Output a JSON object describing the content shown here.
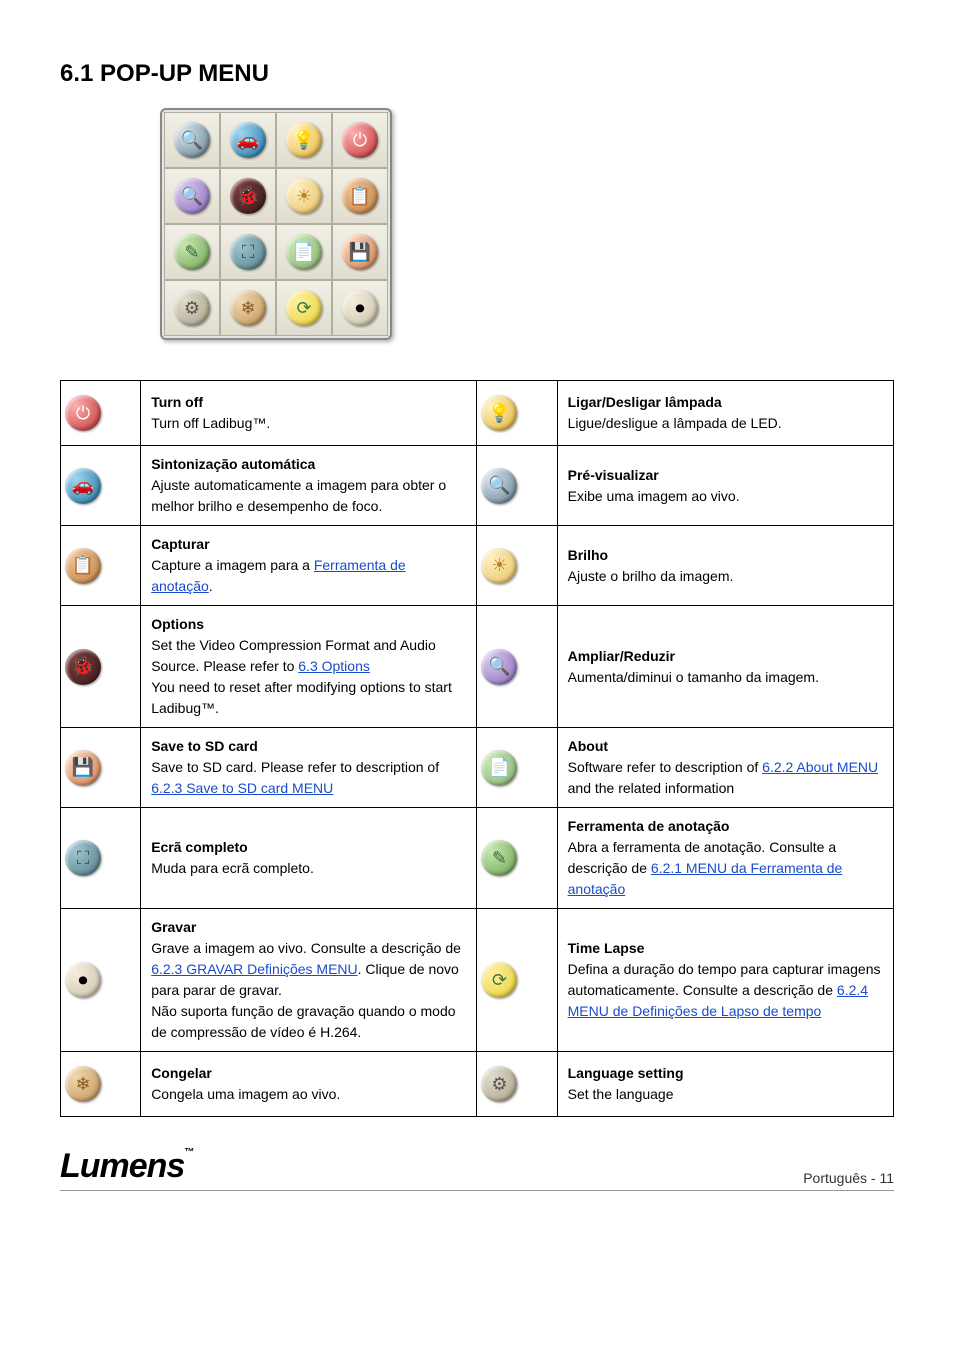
{
  "title": "6.1 POP-UP MENU",
  "toolbar": [
    [
      "preview",
      "auto",
      "lamp",
      "power"
    ],
    [
      "zoom",
      "options",
      "bright",
      "capture"
    ],
    [
      "annot",
      "full",
      "about",
      "sd"
    ],
    [
      "langset",
      "freeze",
      "timelapse",
      "record"
    ]
  ],
  "rows": [
    {
      "leftIcon": "power",
      "leftHeading": "Turn off",
      "leftText": "Turn off Ladibug™.",
      "rightIcon": "lamp",
      "rightHeading": "Ligar/Desligar lâmpada",
      "rightText": "Ligue/desligue a lâmpada de LED."
    },
    {
      "leftIcon": "auto",
      "leftHeading": "Sintonização automática",
      "leftText": "Ajuste automaticamente a imagem para obter o melhor brilho e desempenho de foco.",
      "rightIcon": "preview",
      "rightHeading": "Pré-visualizar",
      "rightText": "Exibe uma imagem ao vivo."
    },
    {
      "leftIcon": "capture",
      "leftHeading": "Capturar",
      "leftText": "Capture a imagem para a ",
      "leftLink": "Ferramenta de anotação",
      "leftText2": ".",
      "rightIcon": "bright",
      "rightHeading": "Brilho",
      "rightText": "Ajuste o brilho da imagem."
    },
    {
      "leftIcon": "options",
      "leftHeading": "Options",
      "leftText": "Set the Video Compression Format and Audio Source. Please refer to ",
      "leftLink": "6.3 Options",
      "leftText2": "\n<Remark> You need to reset after modifying options to start Ladibug™.",
      "rightIcon": "zoom",
      "rightHeading": "Ampliar/Reduzir",
      "rightText": "Aumenta/diminui o tamanho da imagem."
    },
    {
      "leftIcon": "sd",
      "leftHeading": "Save to SD card",
      "leftText": "Save to SD card. Please refer to description of ",
      "leftLink": "6.2.3 Save to SD card MENU",
      "rightIcon": "about",
      "rightHeading": "About",
      "rightText": "Software refer to description of ",
      "rightLink": "6.2.2 About MENU",
      "rightText2": " and the related information"
    },
    {
      "leftIcon": "full",
      "leftHeading": "Ecrã completo",
      "leftText": "Muda para ecrã completo.",
      "rightIcon": "annot",
      "rightHeading": "Ferramenta de anotação",
      "rightText": "Abra a ferramenta de anotação. Consulte a descrição de ",
      "rightLink": "6.2.1 MENU da Ferramenta de anotação"
    },
    {
      "leftIcon": "record",
      "leftHeading": "Gravar",
      "leftText": "Grave a imagem ao vivo. Consulte a descrição de ",
      "leftLink": "6.2.3 GRAVAR Definições MENU",
      "leftText2": ". Clique de novo para parar de gravar.\n<Nota> Não suporta função de gravação quando o modo de compressão de vídeo é H.264.",
      "rightIcon": "timelapse",
      "rightHeading": "Time Lapse",
      "rightText": "Defina a duração do tempo para capturar imagens automaticamente. Consulte a descrição de ",
      "rightLink": "6.2.4 MENU de Definições de Lapso de tempo"
    },
    {
      "leftIcon": "freeze",
      "leftHeading": "Congelar",
      "leftText": "Congela uma imagem ao vivo.",
      "rightIcon": "langset",
      "rightHeading": "Language setting",
      "rightText": "Set the language"
    }
  ],
  "footer": {
    "brand": "Lumens",
    "tm": "™",
    "page": "Português - 11"
  }
}
